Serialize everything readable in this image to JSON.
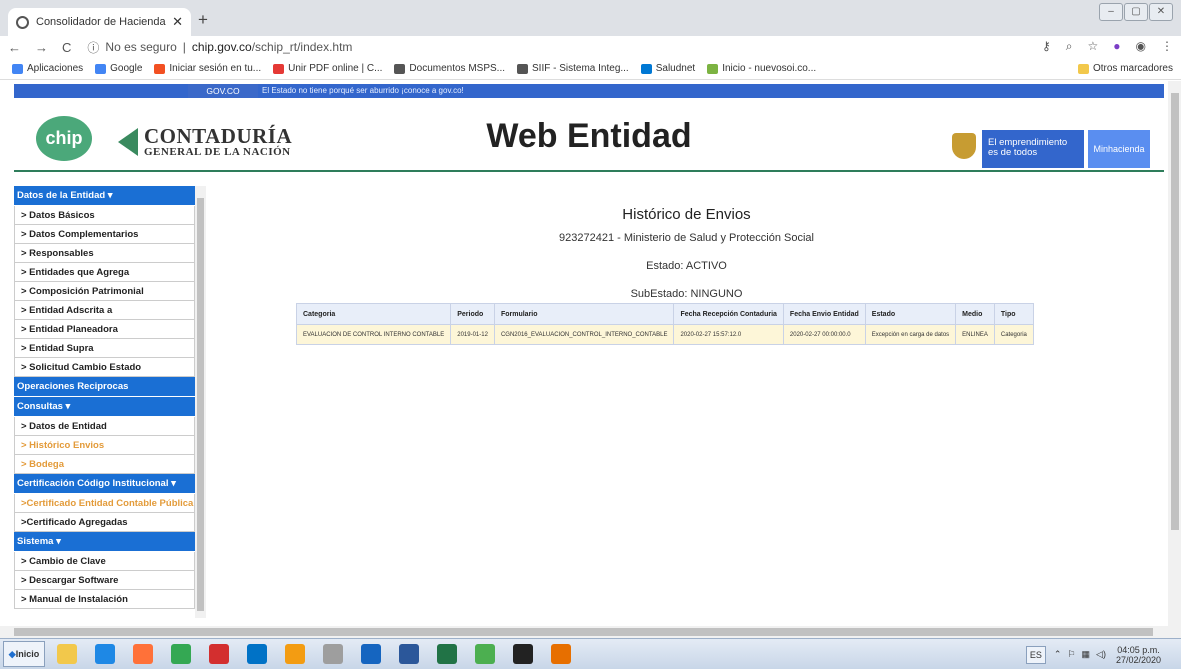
{
  "browser": {
    "tab_title": "Consolidador de Hacienda e Info",
    "tab_close": "✕",
    "new_tab": "+",
    "nav": {
      "back": "←",
      "forward": "→",
      "reload": "C"
    },
    "security": "No es seguro",
    "url_domain": "chip.gov.co",
    "url_path": "/schip_rt/index.htm",
    "bookmarks": [
      {
        "label": "Aplicaciones",
        "icon": "apps-icon",
        "color": "#4285f4"
      },
      {
        "label": "Google",
        "icon": "google-icon",
        "color": "#4285f4"
      },
      {
        "label": "Iniciar sesión en tu...",
        "icon": "windows-icon",
        "color": "#f25022"
      },
      {
        "label": "Unir PDF online | C...",
        "icon": "heart-icon",
        "color": "#e53935"
      },
      {
        "label": "Documentos MSPS...",
        "icon": "globe-icon",
        "color": "#555555"
      },
      {
        "label": "SIIF - Sistema Integ...",
        "icon": "globe-icon",
        "color": "#555555"
      },
      {
        "label": "Saludnet",
        "icon": "windows-icon",
        "color": "#0078d4"
      },
      {
        "label": "Inicio - nuevosoi.co...",
        "icon": "leaf-icon",
        "color": "#7cb342"
      }
    ],
    "other_bookmarks": "Otros marcadores"
  },
  "gov": {
    "brand": "GOV.CO",
    "message": "El Estado no tiene porqué ser aburrido ¡conoce a gov.co!"
  },
  "header": {
    "chip_logo": "chip",
    "cgn_line1": "CONTADURÍA",
    "cgn_line2": "GENERAL DE LA NACIÓN",
    "title": "Web Entidad",
    "emprendimiento": "El emprendimiento es de todos",
    "minhacienda": "Minhacienda"
  },
  "sidebar": [
    {
      "type": "section",
      "label": "Datos de la Entidad ▾"
    },
    {
      "type": "item",
      "label": "> Datos Básicos"
    },
    {
      "type": "item",
      "label": "> Datos Complementarios"
    },
    {
      "type": "item",
      "label": "> Responsables"
    },
    {
      "type": "item",
      "label": "> Entidades que Agrega"
    },
    {
      "type": "item",
      "label": "> Composición Patrimonial"
    },
    {
      "type": "item",
      "label": "> Entidad Adscrita a"
    },
    {
      "type": "item",
      "label": "> Entidad Planeadora"
    },
    {
      "type": "item",
      "label": "> Entidad Supra"
    },
    {
      "type": "item",
      "label": "> Solicitud Cambio Estado"
    },
    {
      "type": "section",
      "label": "Operaciones Reciprocas"
    },
    {
      "type": "section",
      "label": "Consultas ▾"
    },
    {
      "type": "item",
      "label": "> Datos de Entidad"
    },
    {
      "type": "item",
      "label": "> Histórico Envios",
      "active": true
    },
    {
      "type": "item",
      "label": "> Bodega",
      "active": true
    },
    {
      "type": "section",
      "label": "Certificación Código Institucional ▾"
    },
    {
      "type": "item",
      "label": ">Certificado Entidad Contable Pública",
      "active": true
    },
    {
      "type": "item",
      "label": ">Certificado Agregadas"
    },
    {
      "type": "section",
      "label": "Sistema ▾"
    },
    {
      "type": "item",
      "label": "> Cambio de Clave"
    },
    {
      "type": "item",
      "label": "> Descargar Software"
    },
    {
      "type": "item",
      "label": "> Manual de Instalación"
    }
  ],
  "content": {
    "title": "Histórico de Envios",
    "entity": "923272421 - Ministerio de Salud y Protección Social",
    "estado": "Estado: ACTIVO",
    "subestado": "SubEstado: NINGUNO",
    "columns": [
      "Categoria",
      "Periodo",
      "Formulario",
      "Fecha Recepción Contaduria",
      "Fecha Envio Entidad",
      "Estado",
      "Medio",
      "Tipo"
    ],
    "rows": [
      [
        "EVALUACION DE CONTROL INTERNO CONTABLE",
        "2019-01-12",
        "CGN2016_EVALUACION_CONTROL_INTERNO_CONTABLE",
        "2020-02-27 15:57:12.0",
        "2020-02-27 00:00:00.0",
        "Excepción en carga de datos",
        "ENLINEA",
        "Categoria"
      ]
    ]
  },
  "taskbar": {
    "start": "Inicio",
    "apps": [
      {
        "icon": "folder-icon",
        "color": "#f2c84b"
      },
      {
        "icon": "ie-icon",
        "color": "#1e88e5"
      },
      {
        "icon": "firefox-icon",
        "color": "#ff7139"
      },
      {
        "icon": "chrome-icon",
        "color": "#34a853"
      },
      {
        "icon": "acrobat-icon",
        "color": "#d32f2f"
      },
      {
        "icon": "outlook-icon",
        "color": "#0072c6"
      },
      {
        "icon": "access-icon",
        "color": "#f39c12"
      },
      {
        "icon": "calculator-icon",
        "color": "#9e9e9e"
      },
      {
        "icon": "paint-icon",
        "color": "#1565c0"
      },
      {
        "icon": "word-icon",
        "color": "#2b579a"
      },
      {
        "icon": "excel-icon",
        "color": "#217346"
      },
      {
        "icon": "notepad-icon",
        "color": "#4caf50"
      },
      {
        "icon": "cmd-icon",
        "color": "#222222"
      },
      {
        "icon": "java-icon",
        "color": "#e76f00"
      }
    ],
    "lang": "ES",
    "time": "04:05 p.m.",
    "date": "27/02/2020"
  }
}
